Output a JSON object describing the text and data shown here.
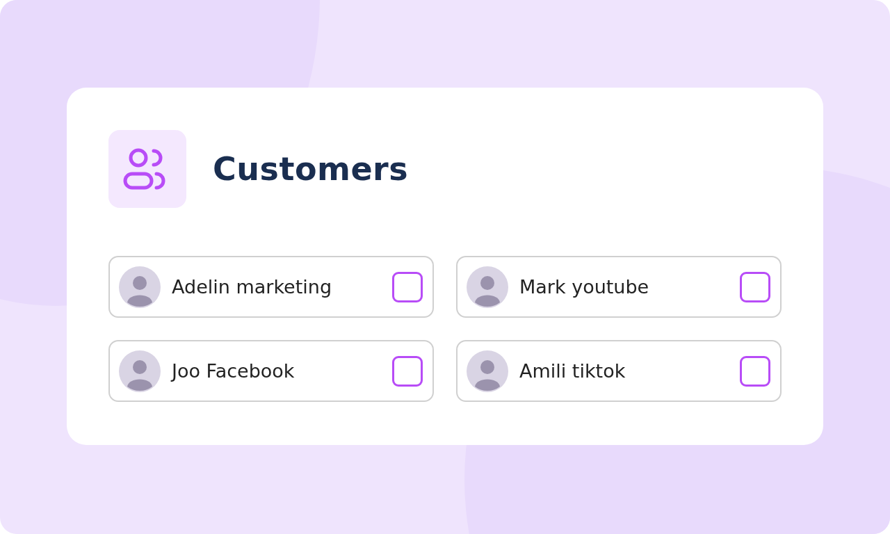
{
  "title": "Customers",
  "customers": [
    {
      "name": "Adelin marketing",
      "checked": false
    },
    {
      "name": "Mark youtube",
      "checked": false
    },
    {
      "name": "Joo Facebook",
      "checked": false
    },
    {
      "name": "Amili tiktok",
      "checked": false
    }
  ]
}
